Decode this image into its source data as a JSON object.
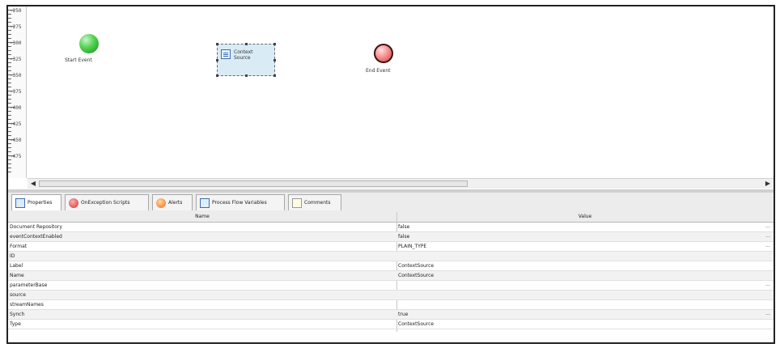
{
  "canvas": {
    "ruler_labels": [
      "-250",
      "-275",
      "-300",
      "-325",
      "-350",
      "-375",
      "-400",
      "-425",
      "-450",
      "-475"
    ],
    "start_event_label": "Start Event",
    "task_label": "Context Source",
    "end_event_label": "End Event",
    "scroll_left_arrow": "◀",
    "scroll_right_arrow": "▶"
  },
  "tabs": [
    {
      "label": "Properties",
      "icon": "properties-icon"
    },
    {
      "label": "OnException Scripts",
      "icon": "script-icon"
    },
    {
      "label": "Alerts",
      "icon": "alert-icon"
    },
    {
      "label": "Process Flow Variables",
      "icon": "variables-icon"
    },
    {
      "label": "Comments",
      "icon": "comments-icon"
    }
  ],
  "table": {
    "headers": {
      "name": "Name",
      "value": "Value"
    },
    "rows": [
      {
        "name": "Document Repository",
        "value": "false",
        "editable": true
      },
      {
        "name": "eventContextEnabled",
        "value": "false",
        "editable": true
      },
      {
        "name": "Format",
        "value": "PLAIN_TYPE",
        "editable": true
      },
      {
        "name": "ID",
        "value": "",
        "editable": false
      },
      {
        "name": "Label",
        "value": "ContextSource",
        "editable": false
      },
      {
        "name": "Name",
        "value": "ContextSource",
        "editable": false
      },
      {
        "name": "parameterBase",
        "value": "",
        "editable": true
      },
      {
        "name": "source",
        "value": "",
        "editable": false
      },
      {
        "name": "streamNames",
        "value": "",
        "editable": false
      },
      {
        "name": "Synch",
        "value": "true",
        "editable": true
      },
      {
        "name": "Type",
        "value": "ContextSource",
        "editable": false
      }
    ],
    "ellipsis": "..."
  }
}
